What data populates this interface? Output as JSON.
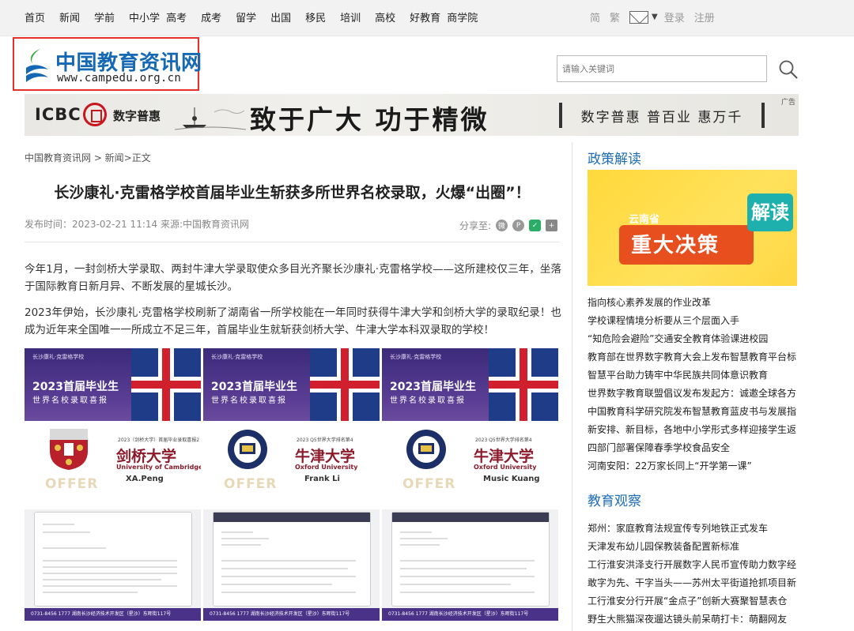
{
  "topnav": {
    "links": [
      "首页",
      "新闻",
      "学前",
      "中小学",
      "高考",
      "成考",
      "留学",
      "出国",
      "移民",
      "培训",
      "高校",
      "好教育",
      "商学院"
    ],
    "simplified": "简",
    "traditional": "繁",
    "login": "登录",
    "register": "注册"
  },
  "logo": {
    "name": "中国教育资讯网",
    "url": "www.campedu.org.cn"
  },
  "search": {
    "placeholder": "请输入关键词"
  },
  "banner": {
    "brand": "ICBC",
    "sub": "数字普惠",
    "slogan": "致于广大 功于精微",
    "scroll": "数字普惠 普百业 惠万千",
    "ad_tag": "广告"
  },
  "breadcrumb": "中国教育资讯网 > 新闻>正文",
  "article": {
    "title": "长沙康礼·克雷格学校首届毕业生斩获多所世界名校录取，火爆“出圈”！",
    "meta": "发布时间：2023-02-21 11:14  来源:中国教育资讯网",
    "share_label": "分享至:",
    "para1": "今年1月，一封剑桥大学录取、两封牛津大学录取使众多目光齐聚长沙康礼·克雷格学校——这所建校仅三年，坐落于国际教育日新月异、不断发展的星城长沙。",
    "para2": "2023年伊始，长沙康礼·克雷格学校刷新了湖南省一所学校能在一年同时获得牛津大学和剑桥大学的录取纪录！也成为近年来全国唯一一所成立不足三年，首届毕业生就斩获剑桥大学、牛津大学本科双录取的学校！"
  },
  "posters": [
    {
      "school": "长沙康礼·克雷格学校",
      "year": "2023首届毕业生",
      "subtitle": "世界名校录取喜报",
      "tagline": "2023（剑桥大学）首届毕业录取喜报2",
      "uni_cn": "剑桥大学",
      "uni_en": "University of Cambridge",
      "student": "XA.Peng",
      "offer": "OFFER",
      "footer": "0731-8456 1777   湖南长沙经济技术开发区（星沙）东晖街117号",
      "crest_color": "#b8202c"
    },
    {
      "school": "长沙康礼·克雷格学校",
      "year": "2023首届毕业生",
      "subtitle": "世界名校录取喜报",
      "tagline": "2023 Q5世界大学排名第4",
      "uni_cn": "牛津大学",
      "uni_en": "Oxford University",
      "student": "Frank Li",
      "offer": "OFFER",
      "footer": "0731-8456 1777   湖南长沙经济技术开发区（星沙）东晖街117号",
      "crest_color": "#1c2f66"
    },
    {
      "school": "长沙康礼·克雷格学校",
      "year": "2023首届毕业生",
      "subtitle": "世界名校录取喜报",
      "tagline": "2023 Q5世界大学排名第4",
      "uni_cn": "牛津大学",
      "uni_en": "Oxford University",
      "student": "Music Kuang",
      "offer": "OFFER",
      "footer": "0731-8456 1777   湖南长沙经济技术开发区（星沙）东晖街117号",
      "crest_color": "#1c2f66"
    }
  ],
  "sidebar": {
    "policy_head": "政策解读",
    "promo": {
      "top": "云南省",
      "main": "重大决策",
      "badge": "解读"
    },
    "policy_news": [
      "指向核心素养发展的作业改革",
      "学校课程情境分析要从三个层面入手",
      "“知危险会避险”交通安全教育体验课进校园",
      "教育部在世界数字教育大会上发布智慧教育平台标",
      "智慧平台助力铸牢中华民族共同体意识教育",
      "世界数字教育联盟倡议发布发起方：诚邀全球各方",
      "中国教育科学研究院发布智慧教育蓝皮书与发展指",
      "新安排、新目标，各地中小学形式多样迎接学生返",
      "四部门部署保障春季学校食品安全",
      "河南安阳：22万家长同上“开学第一课”"
    ],
    "observe_head": "教育观察",
    "observe_news": [
      "郑州：家庭教育法规宣传专列地铁正式发车",
      "天津发布幼儿园保教装备配置新标准",
      "工行淮安洪泽支行开展数字人民币宣传助力数字经",
      "敢字为先、干字当头——苏州太平街道抢抓项目新",
      "工行淮安分行开展“金点子”创新大赛聚智慧表仓",
      "野生大熊猫深夜遛达镜头前呆萌打卡：萌翻网友"
    ]
  }
}
